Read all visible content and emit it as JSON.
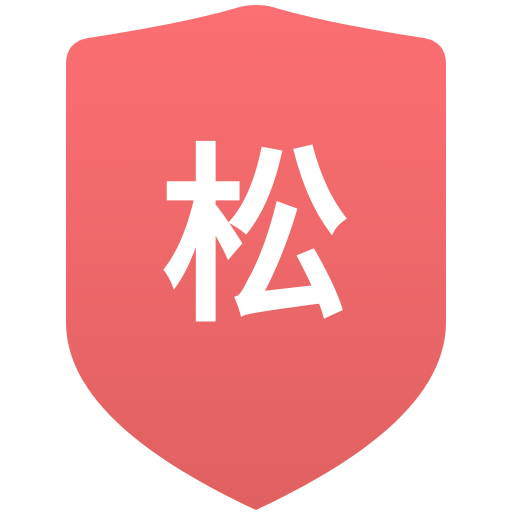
{
  "icon": {
    "name": "shield-icon",
    "glyph": "松",
    "colors": {
      "gradient_top": "#fc6f72",
      "gradient_bottom": "#e06062",
      "glyph": "#ffffff",
      "background": "#ffffff"
    }
  }
}
